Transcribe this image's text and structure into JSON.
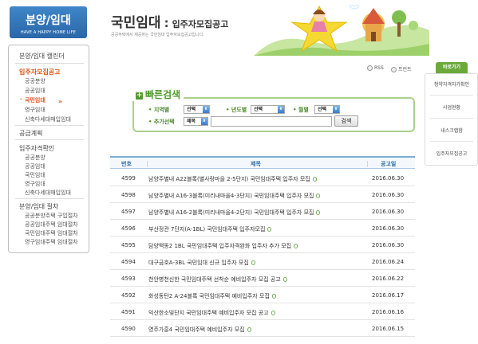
{
  "logo": {
    "main": "분양/임대",
    "sub": "HAVE A HAPPY HOME LIFE"
  },
  "sidebar": {
    "group1_title": "분양/임대 캘린더",
    "group2_title": "입주자모집공고",
    "group2_items": [
      "공공분양",
      "공공임대",
      "국민임대",
      "영구임대",
      "신축다세대매입임대"
    ],
    "group3_title": "공급계획",
    "group4_title": "입주자격확인",
    "group4_items": [
      "공공분양",
      "공공임대",
      "국민임대",
      "영구임대",
      "신축다세대매입임대"
    ],
    "group5_title": "분양/임대 절차",
    "group5_items": [
      "공공분양주택 구입절차",
      "공공임대주택 임대절차",
      "국민임대주택 임대절차",
      "영구임대주택 임대절차"
    ],
    "active_marker": "»"
  },
  "header": {
    "title": "국민임대",
    "colon": ":",
    "subtitle": "입주자모집공고",
    "description": "공공주택에서 제공하는 국민임대 입주자모집공고입니다."
  },
  "utility": {
    "rss": "RSS",
    "print": "프린트"
  },
  "quick": {
    "tab": "바로가기",
    "items": [
      "청약자격자가확인",
      "사업현황",
      "내스크랩함",
      "입주자모집공고"
    ]
  },
  "search": {
    "title": "빠른검색",
    "plus": "+",
    "region_label": "지역별",
    "region_value": "선택",
    "year_label": "년도별",
    "year_value": "선택",
    "month_label": "월별",
    "month_value": "선택",
    "extra_label": "추가선택",
    "extra_value": "제목",
    "input_value": "",
    "button": "검색",
    "dropdown_icon": "⬍"
  },
  "table": {
    "headers": {
      "no": "번호",
      "title": "제목",
      "date": "공고일"
    },
    "rows": [
      {
        "no": "4599",
        "title": "남양주별내 A22블록(별사랑마을 2-5단지) 국민임대주택 입주자 모집",
        "date": "2016.06.30"
      },
      {
        "no": "4598",
        "title": "남양주별내 A16-3블록(미리내마을4-3단지) 국민임대주택 입주자 모집",
        "date": "2016.06.30"
      },
      {
        "no": "4597",
        "title": "남양주별내 A16-2블록(미리내마을4-2단지) 국민임대주택 입주자 모집",
        "date": "2016.06.30"
      },
      {
        "no": "4596",
        "title": "부산정관 7단지(A-1BL) 국민임대주택 입주자모집",
        "date": "2016.06.30"
      },
      {
        "no": "4595",
        "title": "담양백동2 1BL 국민임대주택 입주자격완화 입주자 추가 모집",
        "date": "2016.06.30"
      },
      {
        "no": "4594",
        "title": "대구금호A-3BL 국민임대 신규 입주자 모집",
        "date": "2016.06.24"
      },
      {
        "no": "4593",
        "title": "천안병천신한 국민임대주택 선착순 예비입주자 모집 공고",
        "date": "2016.06.22"
      },
      {
        "no": "4592",
        "title": "화성동탄2 A-24블록 국민임대주택 예비입주자 모집",
        "date": "2016.06.17"
      },
      {
        "no": "4591",
        "title": "익산한소빛단지 국민임대주택 예비입주자 모집 공고",
        "date": "2016.06.16"
      },
      {
        "no": "4590",
        "title": "영주가흥4 국민임대주택 예비입주자 모집",
        "date": "2016.06.15"
      }
    ]
  },
  "colors": {
    "accent_green": "#4f9a2b",
    "accent_orange": "#e05414",
    "header_blue": "#2d6aa5",
    "logo_blue": "#3f86c9"
  }
}
